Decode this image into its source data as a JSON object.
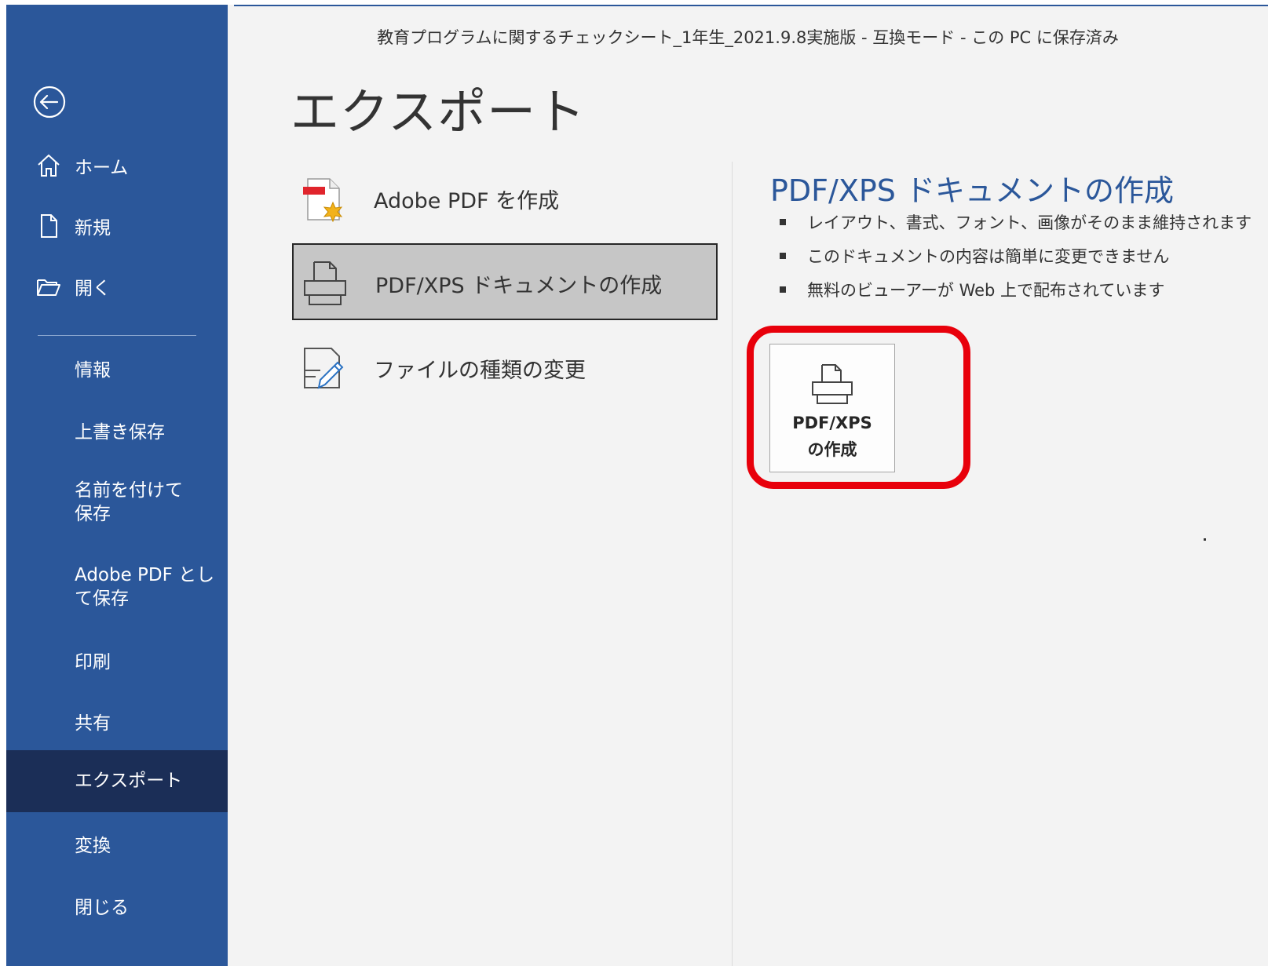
{
  "window": {
    "title": "教育プログラムに関するチェックシート_1年生_2021.9.8実施版  -  互換モード - この PC に保存済み"
  },
  "sidebar": {
    "back_icon": "back-arrow-icon",
    "top_items": [
      {
        "label": "ホーム",
        "icon": "home-icon"
      },
      {
        "label": "新規",
        "icon": "new-document-icon"
      },
      {
        "label": "開く",
        "icon": "open-folder-icon"
      }
    ],
    "items": [
      {
        "label": "情報"
      },
      {
        "label": "上書き保存"
      },
      {
        "label": "名前を付けて保存"
      },
      {
        "label": "Adobe PDF として保存"
      },
      {
        "label": "印刷"
      },
      {
        "label": "共有"
      },
      {
        "label": "エクスポート",
        "active": true
      },
      {
        "label": "変換"
      },
      {
        "label": "閉じる"
      }
    ],
    "colors": {
      "background": "#2b579a",
      "active": "#1b2e57"
    }
  },
  "page": {
    "title": "エクスポート"
  },
  "export_options": [
    {
      "label": "Adobe PDF を作成",
      "icon": "adobe-pdf-icon"
    },
    {
      "label": "PDF/XPS ドキュメントの作成",
      "icon": "printer-icon",
      "selected": true
    },
    {
      "label": "ファイルの種類の変更",
      "icon": "change-file-type-icon"
    }
  ],
  "detail": {
    "heading": "PDF/XPS ドキュメントの作成",
    "bullets": [
      "レイアウト、書式、フォント、画像がそのまま維持されます",
      "このドキュメントの内容は簡単に変更できません",
      "無料のビューアーが Web 上で配布されています"
    ],
    "button": {
      "line1": "PDF/XPS",
      "line2": "の作成",
      "icon": "printer-icon"
    },
    "highlight_color": "#e8000b",
    "accent_color": "#2b579a"
  }
}
